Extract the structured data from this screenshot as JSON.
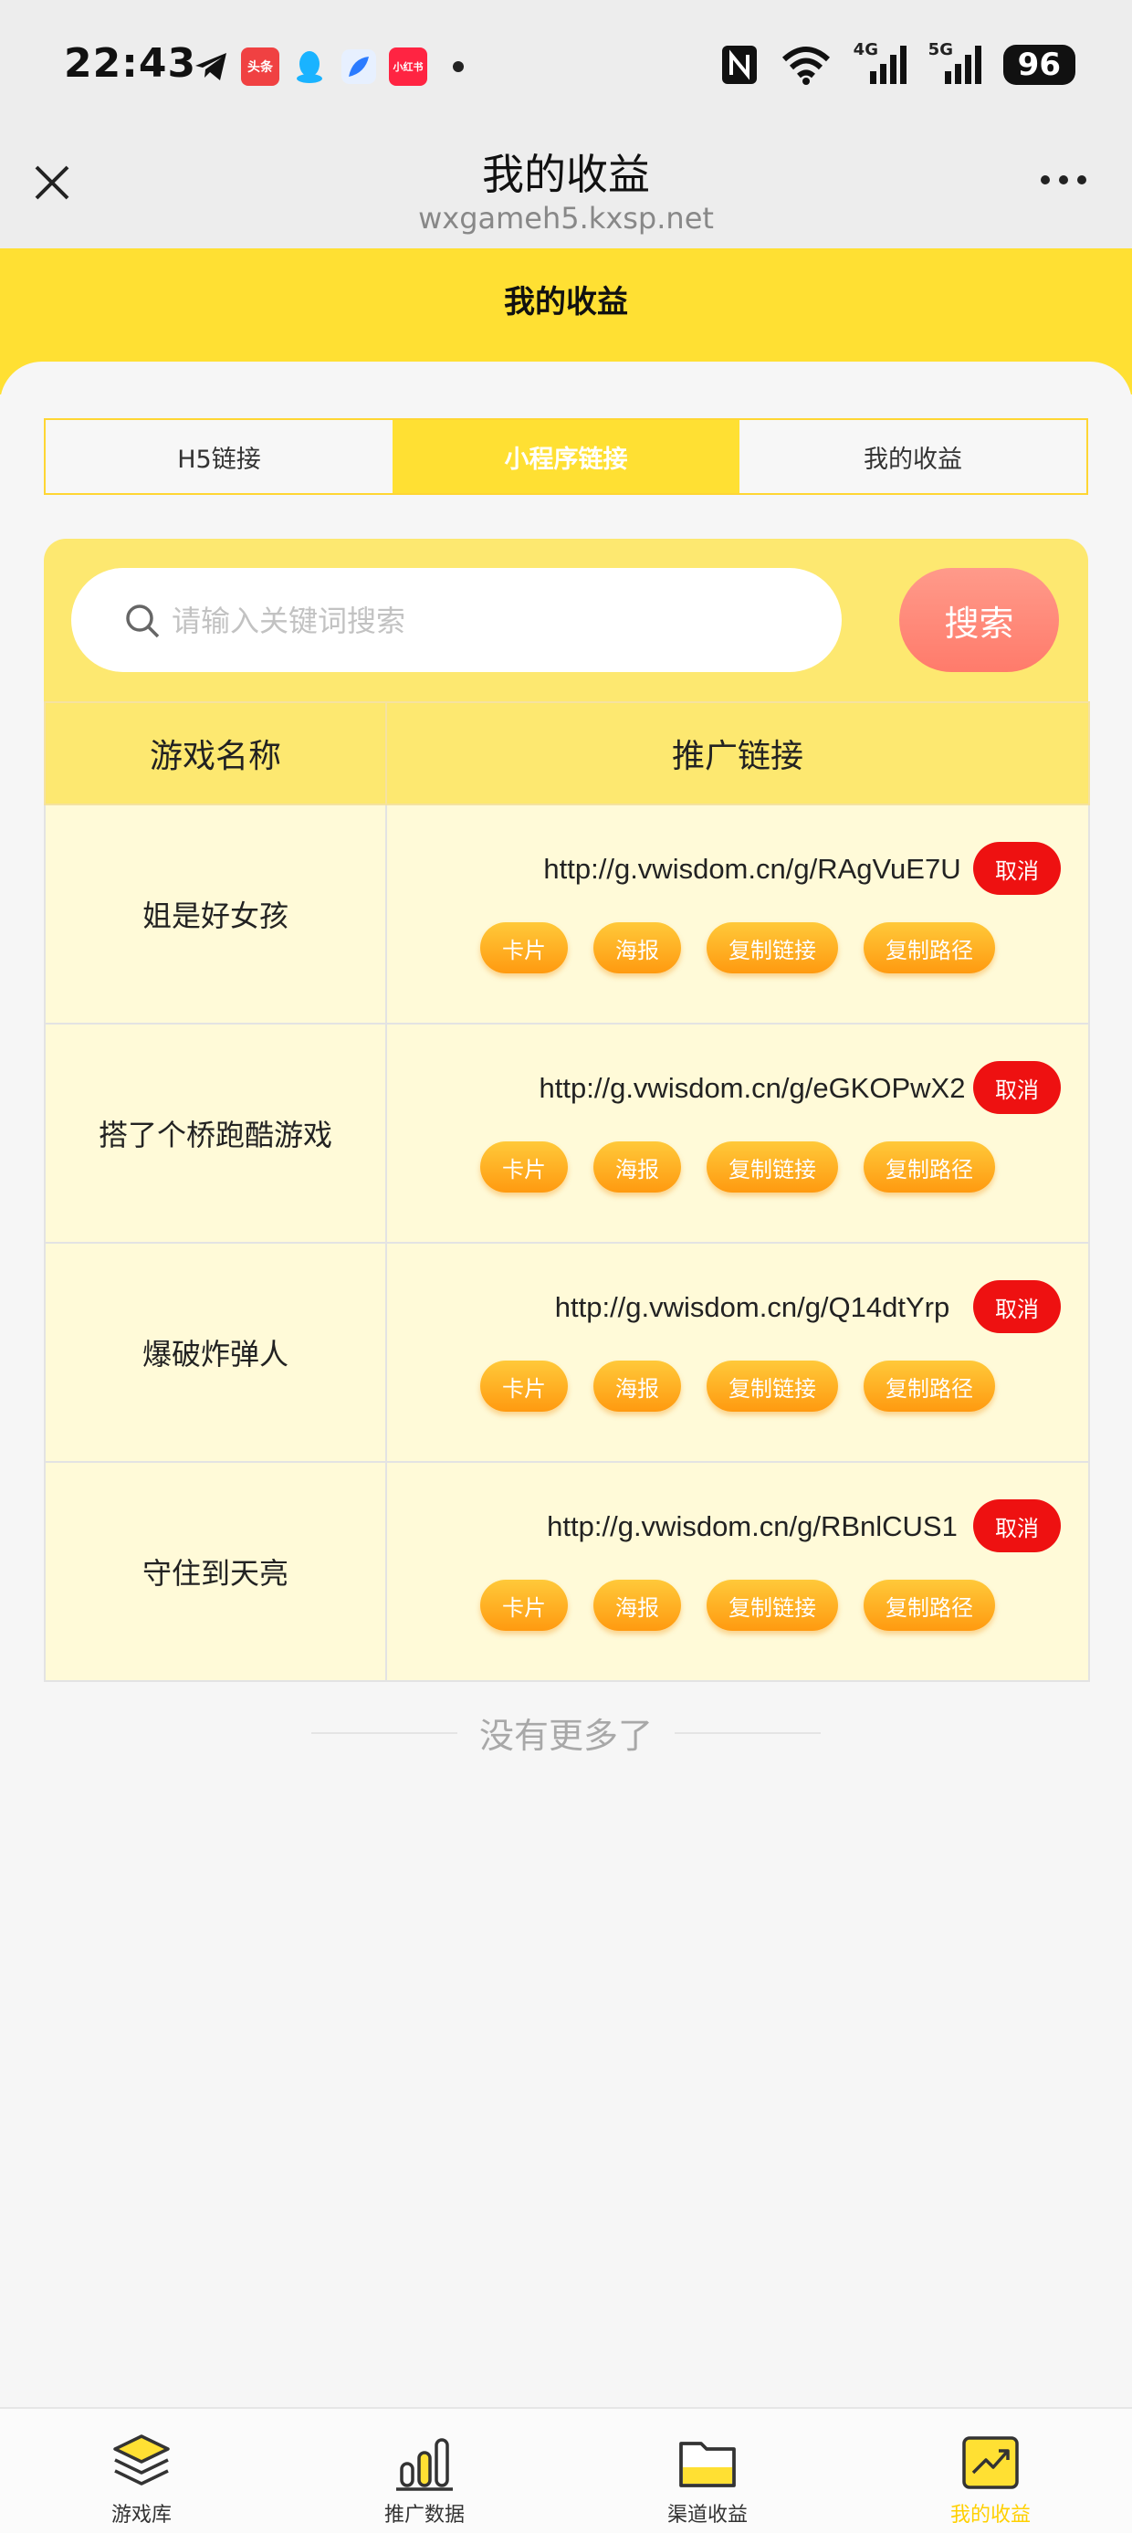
{
  "status_bar": {
    "time": "22:43",
    "app_badges": [
      "头条",
      "小红书"
    ],
    "network": [
      "4G",
      "5G"
    ],
    "battery": "96"
  },
  "nav": {
    "title": "我的收益",
    "subtitle": "wxgameh5.kxsp.net"
  },
  "header": {
    "title": "我的收益"
  },
  "tabs": [
    {
      "label": "H5链接",
      "active": false
    },
    {
      "label": "小程序链接",
      "active": true
    },
    {
      "label": "我的收益",
      "active": false
    }
  ],
  "search": {
    "placeholder": "请输入关键词搜索",
    "button_label": "搜索"
  },
  "table": {
    "headers": [
      "游戏名称",
      "推广链接"
    ],
    "rows": [
      {
        "name": "姐是好女孩",
        "url": "http://g.vwisdom.cn/g/RAgVuE7U"
      },
      {
        "name": "搭了个桥跑酷游戏",
        "url": "http://g.vwisdom.cn/g/eGKOPwX2"
      },
      {
        "name": "爆破炸弹人",
        "url": "http://g.vwisdom.cn/g/Q14dtYrp"
      },
      {
        "name": "守住到天亮",
        "url": "http://g.vwisdom.cn/g/RBnlCUS1"
      }
    ],
    "row_actions": {
      "cancel": "取消",
      "card": "卡片",
      "poster": "海报",
      "copy_link": "复制链接",
      "copy_path": "复制路径"
    }
  },
  "no_more_text": "没有更多了",
  "bottom_nav": [
    {
      "label": "游戏库",
      "icon": "layers-icon",
      "active": false
    },
    {
      "label": "推广数据",
      "icon": "bar-chart-icon",
      "active": false
    },
    {
      "label": "渠道收益",
      "icon": "folder-icon",
      "active": false
    },
    {
      "label": "我的收益",
      "icon": "trend-chart-icon",
      "active": true
    }
  ],
  "colors": {
    "accent": "#ffe033",
    "cancel": "#ee1111",
    "action": "#ffa515",
    "search_button": "#ff8a7a"
  }
}
